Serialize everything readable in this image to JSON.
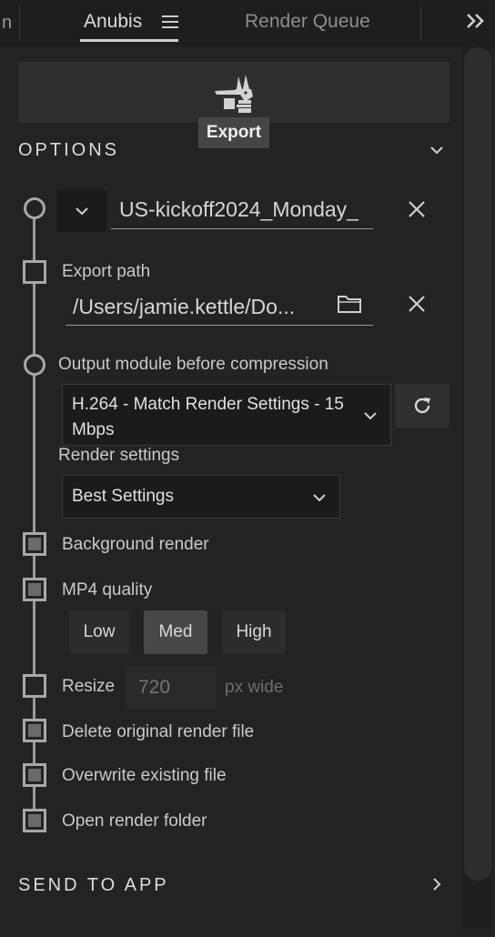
{
  "tabs": {
    "left_fragment": "n",
    "active": "Anubis",
    "queue": "Render Queue"
  },
  "export": {
    "tooltip": "Export"
  },
  "options": {
    "title": "OPTIONS",
    "comp_name": "US-kickoff2024_Monday_",
    "export_path_label": "Export path",
    "export_path_value": "/Users/jamie.kettle/Do...",
    "output_module_label": "Output module before compression",
    "output_module_value": "H.264 - Match Render Settings - 15 Mbps",
    "render_settings_label": "Render settings",
    "render_settings_value": "Best Settings",
    "background_render_label": "Background render",
    "mp4_quality_label": "MP4 quality",
    "quality_options": [
      "Low",
      "Med",
      "High"
    ],
    "quality_selected": "Med",
    "resize_label": "Resize",
    "resize_placeholder": "720",
    "resize_unit": "px wide",
    "delete_original_label": "Delete original render file",
    "overwrite_label": "Overwrite existing file",
    "open_folder_label": "Open render folder"
  },
  "send_to_app": {
    "title": "SEND TO APP"
  },
  "colors": {
    "background": "#232323",
    "panel_dark": "#1b1b1b",
    "accent_gray": "#a8a8a8",
    "active_segment": "#474747"
  }
}
